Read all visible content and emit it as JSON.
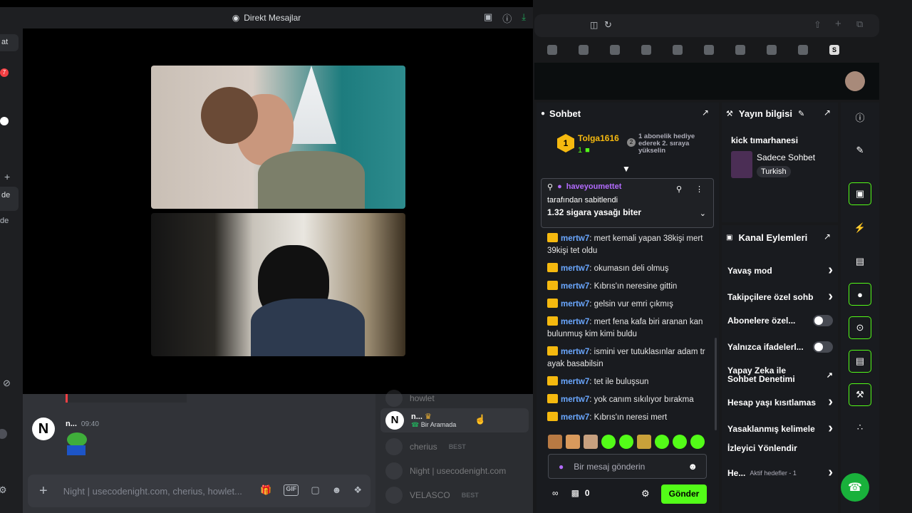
{
  "discord": {
    "window_title": "Direkt Mesajlar",
    "titlebar_icons": [
      "inbox-icon",
      "help-icon",
      "download-icon"
    ],
    "strip": {
      "item1": "at",
      "badge": "7",
      "item_de1": "de",
      "item_de2": "de"
    },
    "message": {
      "author": "n...",
      "time": "09:40",
      "avatar_letter": "N"
    },
    "input_placeholder": "Night | usecodenight.com, cherius, howlet...",
    "members": [
      {
        "name": "howlet",
        "badge": ""
      },
      {
        "name": "n...",
        "status": "Bir Aramada",
        "crown": "♛"
      },
      {
        "name": "cherius",
        "badge": "BEST"
      },
      {
        "name": "Night | usecodenight.com",
        "badge": ""
      },
      {
        "name": "VELASCO",
        "badge": "BEST"
      }
    ]
  },
  "kick": {
    "chat": {
      "title": "Sohbet",
      "top_gifter": {
        "name": "Tolga1616",
        "rank": "1",
        "count": "1"
      },
      "gift_cta": {
        "rank": "2",
        "text": "1 abonelik hediye ederek 2. sıraya yükselin"
      },
      "pinned": {
        "user": "haveyoumettet",
        "by": "tarafından sabitlendi",
        "text": "1.32 sigara yasağı biter"
      },
      "messages": [
        {
          "user": "mertw7",
          "text": ": mert kemali yapan 38kişi mert 39kişi tet oldu"
        },
        {
          "user": "mertw7",
          "text": ": okumasın deli olmuş"
        },
        {
          "user": "mertw7",
          "text": ": Kıbrıs'ın neresine gittin"
        },
        {
          "user": "mertw7",
          "text": ": gelsin vur emri çıkmış"
        },
        {
          "user": "mertw7",
          "text": ": mert fena kafa biri aranan kan bulunmuş kim kimi buldu"
        },
        {
          "user": "mertw7",
          "text": ": ismini ver tutuklasınlar adam tr ayak basabilsin"
        },
        {
          "user": "mertw7",
          "text": ": tet ile buluşsun"
        },
        {
          "user": "mertw7",
          "text": ": yok canım sıkılıyor bırakma"
        },
        {
          "user": "mertw7",
          "text": ": Kıbrıs'ın neresi mert"
        }
      ],
      "input_placeholder": "Bir mesaj gönderin",
      "points": "0",
      "send_label": "Gönder"
    },
    "info": {
      "title": "Yayın bilgisi",
      "stream_title": "kick tımarhanesi",
      "category": "Sadece Sohbet",
      "language": "Turkish"
    },
    "actions": {
      "title": "Kanal Eylemleri",
      "rows": [
        {
          "label": "Yavaş mod",
          "control": "chevron"
        },
        {
          "label": "Takipçilere özel sohb",
          "control": "chevron"
        },
        {
          "label": "Abonelere özel...",
          "control": "toggle"
        },
        {
          "label": "Yalnızca ifadelerl...",
          "control": "toggle"
        },
        {
          "label": "Yapay Zeka ile Sohbet Denetimi",
          "control": "external"
        },
        {
          "label": "Hesap yaşı kısıtlamas",
          "control": "chevron"
        },
        {
          "label": "Yasaklanmış kelimele",
          "control": "chevron"
        },
        {
          "label": "İzleyici Yönlendir",
          "control": "none"
        },
        {
          "label": "He...",
          "sub": "Aktif hedefler - 1",
          "control": "chevron"
        }
      ]
    },
    "accent": "#53fc18"
  }
}
